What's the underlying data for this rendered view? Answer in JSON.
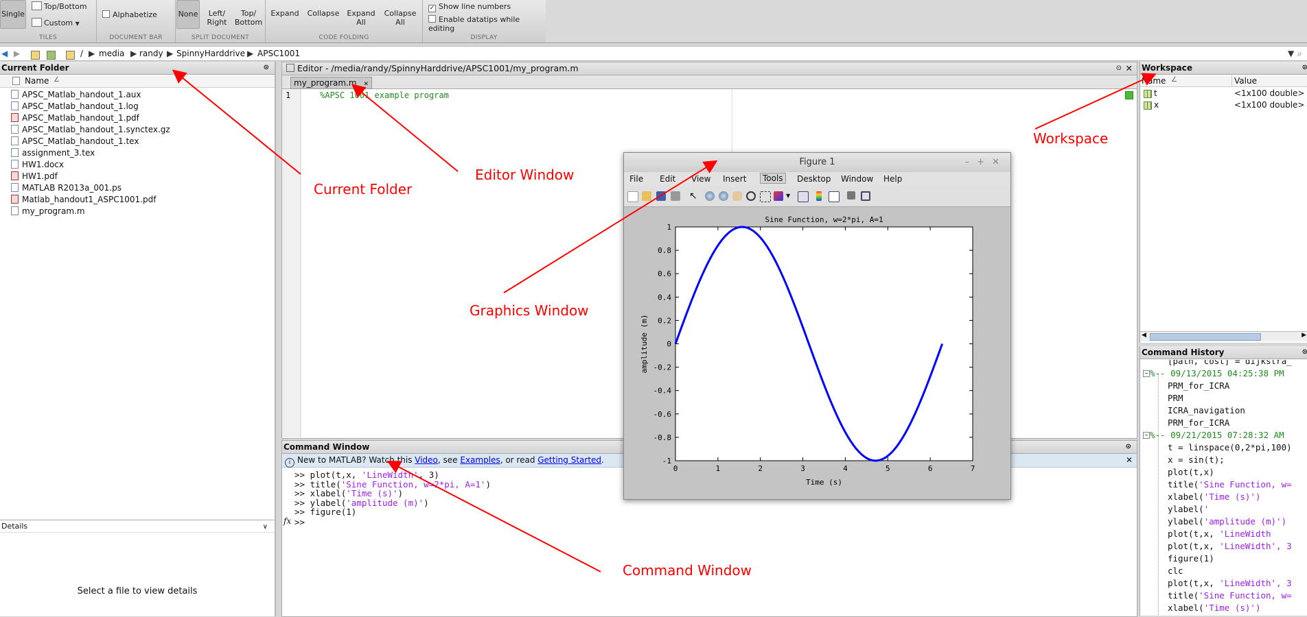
{
  "ribbon": {
    "tiles": {
      "single": "Single",
      "top_bottom": "Top/Bottom",
      "custom": "Custom",
      "label": "TILES"
    },
    "document_bar": {
      "alphabetize": "Alphabetize",
      "label": "DOCUMENT BAR"
    },
    "split_document": {
      "none": "None",
      "left_right": "Left/\nRight",
      "top_bottom": "Top/\nBottom",
      "label": "SPLIT DOCUMENT"
    },
    "code_folding": {
      "expand": "Expand",
      "collapse": "Collapse",
      "expand_all": "Expand\nAll",
      "collapse_all": "Collapse\nAll",
      "label": "CODE FOLDING"
    },
    "display": {
      "show_line_numbers": "Show line numbers",
      "enable_datatips": "Enable datatips while editing",
      "label": "DISPLAY"
    }
  },
  "address": {
    "segments": [
      "/",
      "media",
      "randy",
      "SpinnyHarddrive",
      "APSC1001"
    ]
  },
  "current_folder": {
    "title": "Current Folder",
    "column": "Name",
    "files": [
      {
        "name": "APSC_Matlab_handout_1.aux",
        "type": "doc"
      },
      {
        "name": "APSC_Matlab_handout_1.log",
        "type": "doc"
      },
      {
        "name": "APSC_Matlab_handout_1.pdf",
        "type": "pdf"
      },
      {
        "name": "APSC_Matlab_handout_1.synctex.gz",
        "type": "doc"
      },
      {
        "name": "APSC_Matlab_handout_1.tex",
        "type": "doc"
      },
      {
        "name": "assignment_3.tex",
        "type": "doc"
      },
      {
        "name": "HW1.docx",
        "type": "doc"
      },
      {
        "name": "HW1.pdf",
        "type": "pdf"
      },
      {
        "name": "MATLAB R2013a_001.ps",
        "type": "doc"
      },
      {
        "name": "Matlab_handout1_ASPC1001.pdf",
        "type": "pdf"
      },
      {
        "name": "my_program.m",
        "type": "m"
      }
    ]
  },
  "details": {
    "title": "Details",
    "message": "Select a file to view details"
  },
  "editor": {
    "title": "Editor - /media/randy/SpinnyHarddrive/APSC1001/my_program.m",
    "tab": "my_program.m",
    "line_no": "1",
    "code": "%APSC 1001 example program"
  },
  "command_window": {
    "title": "Command Window",
    "info_prefix": "New to MATLAB? Watch this ",
    "info_video": "Video",
    "info_mid": ", see ",
    "info_examples": "Examples",
    "info_mid2": ", or read ",
    "info_started": "Getting Started",
    "info_end": ".",
    "lines": [
      {
        "cmd": ">> plot(t,x, ",
        "str": "'LineWidth'",
        "rest": ", 3)"
      },
      {
        "cmd": ">> title(",
        "str": "'Sine Function, w=2*pi, A=1'",
        "rest": ")"
      },
      {
        "cmd": ">> xlabel(",
        "str": "'Time (s)'",
        "rest": ")"
      },
      {
        "cmd": ">> ylabel(",
        "str": "'amplitude (m)'",
        "rest": ")"
      },
      {
        "cmd": ">> figure(1)",
        "str": "",
        "rest": ""
      }
    ],
    "prompt": ">>",
    "fx": "fx"
  },
  "workspace": {
    "title": "Workspace",
    "col_name": "Name",
    "col_value": "Value",
    "vars": [
      {
        "name": "t",
        "value": "<1x100 double>"
      },
      {
        "name": "x",
        "value": "<1x100 double>"
      }
    ]
  },
  "history": {
    "title": "Command History",
    "top_cut": "[path, cost] = dijkstra_",
    "sessions": [
      {
        "stamp": "%-- 09/13/2015 04:25:38 PM",
        "cmds": [
          "PRM_for_ICRA",
          "PRM",
          "ICRA_navigation",
          "PRM_for_ICRA"
        ]
      },
      {
        "stamp": "%-- 09/21/2015 07:28:32 AM",
        "cmds": [
          {
            "a": "t = linspace(0,2*pi,100)",
            "s": ""
          },
          {
            "a": "x = sin(t);",
            "s": ""
          },
          {
            "a": "plot(t,x)",
            "s": ""
          },
          {
            "a": "title(",
            "s": "'Sine Function, w="
          },
          {
            "a": "xlabel(",
            "s": "'Time (s)')"
          },
          {
            "a": "ylabel(",
            "s": "'"
          },
          {
            "a": "ylabel(",
            "s": "'amplitude (m)')"
          },
          {
            "a": "plot(t,x, ",
            "s": "'LineWidth"
          },
          {
            "a": "plot(t,x, ",
            "s": "'LineWidth', 3"
          },
          {
            "a": "figure(1)",
            "s": ""
          },
          {
            "a": "clc",
            "s": ""
          },
          {
            "a": "plot(t,x, ",
            "s": "'LineWidth', 3"
          },
          {
            "a": "title(",
            "s": "'Sine Function, w="
          },
          {
            "a": "xlabel(",
            "s": "'Time (s)')"
          }
        ]
      }
    ]
  },
  "figure": {
    "title": "Figure 1",
    "menu": [
      "File",
      "Edit",
      "View",
      "Insert",
      "Tools",
      "Desktop",
      "Window",
      "Help"
    ]
  },
  "chart_data": {
    "type": "line",
    "title": "Sine Function, w=2*pi, A=1",
    "xlabel": "Time (s)",
    "ylabel": "amplitude (m)",
    "xlim": [
      0,
      7
    ],
    "ylim": [
      -1,
      1
    ],
    "xticks": [
      0,
      1,
      2,
      3,
      4,
      5,
      6,
      7
    ],
    "yticks": [
      -1,
      -0.8,
      -0.6,
      -0.4,
      -0.2,
      0,
      0.2,
      0.4,
      0.6,
      0.8,
      1
    ],
    "series": [
      {
        "function": "sin(t)",
        "x_range": [
          0,
          6.2832
        ],
        "points": 100,
        "color": "#0000ff"
      }
    ]
  },
  "annotations": {
    "current_folder": "Current Folder",
    "editor": "Editor Window",
    "graphics": "Graphics Window",
    "workspace": "Workspace",
    "command": "Command Window",
    "color": "#ff0000"
  }
}
